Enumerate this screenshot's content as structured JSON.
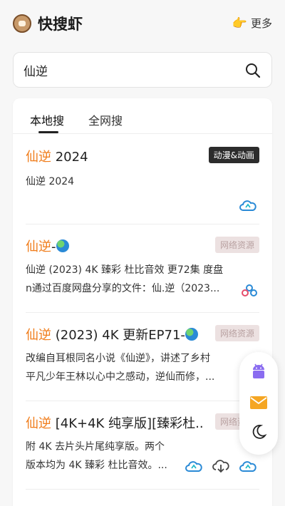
{
  "header": {
    "app_title": "快搜虾",
    "more_label": "更多"
  },
  "search": {
    "query": "仙逆"
  },
  "tabs": [
    {
      "label": "本地搜",
      "active": true
    },
    {
      "label": "全网搜",
      "active": false
    }
  ],
  "results": [
    {
      "title_highlight": "仙逆",
      "title_rest": " 2024",
      "badge": "动漫&动画",
      "badge_style": "dark",
      "desc_line1": "仙逆 2024",
      "desc_line2": ""
    },
    {
      "title_highlight": "仙逆",
      "title_rest": "-",
      "badge": "网络资源",
      "badge_style": "light",
      "desc_line1": "仙逆 (2023) 4K 臻彩 杜比音效 更72集 度盘",
      "desc_line2": "n通过百度网盘分享的文件：仙.逆（2023..."
    },
    {
      "title_highlight": "仙逆",
      "title_rest": " (2023) 4K 更新EP71-",
      "badge": "网络资源",
      "badge_style": "light",
      "desc_line1": "改编自耳根同名小说《仙逆》，讲述了乡村",
      "desc_line2": "平凡少年王林以心中之感动，逆仙而修，..."
    },
    {
      "title_highlight": "仙逆",
      "title_rest": " [4K+4K 纯享版][臻彩杜...",
      "badge": "网络资源",
      "badge_style": "light",
      "desc_line1": "附 4K 去片头片尾纯享版。两个",
      "desc_line2": "版本均为 4K 臻彩 杜比音效。..."
    }
  ],
  "colors": {
    "highlight": "#f07c1a",
    "accent_blue": "#2a8ad6"
  },
  "icons": [
    "logo-icon",
    "pointing-hand-icon",
    "search-icon",
    "cloud-icon",
    "download-icon",
    "android-icon",
    "mail-icon",
    "moon-icon",
    "globe-emoji-icon"
  ]
}
